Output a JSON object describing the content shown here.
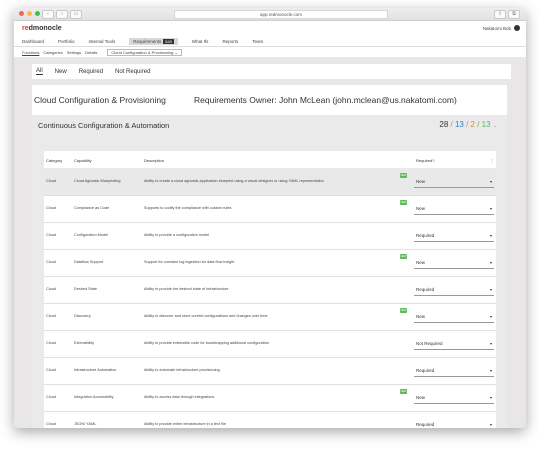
{
  "browser": {
    "url": "app.redmonocle.com",
    "colors": {
      "close": "#fc605c",
      "minimize": "#fdbc40",
      "maximize": "#34c84a"
    }
  },
  "app": {
    "logo_prefix": "re",
    "logo_suffix": "dmonocle",
    "user_name": "Nakatomi Bob"
  },
  "mainnav": {
    "items": [
      "Dashboard",
      "Portfolio",
      "Internal Tools",
      "Requirements",
      "What Ifs",
      "Reports",
      "Team"
    ],
    "requirements_badge": "543"
  },
  "subnav": {
    "items": [
      "Functions",
      "Categories",
      "Settings",
      "Details"
    ],
    "selected": "Cloud Configuration & Provisioning"
  },
  "filters": [
    "All",
    "New",
    "Required",
    "Not Required"
  ],
  "page": {
    "title": "Cloud Configuration & Provisioning",
    "owner": "Requirements Owner: John McLean (john.mclean@us.nakatomi.com)"
  },
  "section": {
    "title": "Continuous Configuration & Automation",
    "counts": {
      "total": "28",
      "blue": "13",
      "orange": "2",
      "green": "13"
    },
    "count_colors": {
      "total": "#333333",
      "blue": "#3a7fc4",
      "orange": "#e0902a",
      "green": "#5cb85c"
    }
  },
  "table": {
    "headers": {
      "category": "Category",
      "capability": "Capability",
      "description": "Description",
      "required": "Required?"
    },
    "new_tag": "NEW",
    "rows": [
      {
        "category": "Cloud",
        "capability": "Cloud Agnostic Blueprinting",
        "description": "Ability to create a cloud agnostic application blueprint using a visual designer or using YAML representation",
        "required": "New",
        "is_new": true
      },
      {
        "category": "Cloud",
        "capability": "Compliance as Code",
        "description": "Supports to codify the compliance with custom rules",
        "required": "New",
        "is_new": true
      },
      {
        "category": "Cloud",
        "capability": "Configuration Model",
        "description": "Ability to provide a configuration model",
        "required": "Required",
        "is_new": false
      },
      {
        "category": "Cloud",
        "capability": "Dataflow Support",
        "description": "Support for constant log ingestion for data flow insight",
        "required": "New",
        "is_new": true
      },
      {
        "category": "Cloud",
        "capability": "Desired State",
        "description": "Ability to provide the desired state of infrastructure",
        "required": "Required",
        "is_new": false
      },
      {
        "category": "Cloud",
        "capability": "Discovery",
        "description": "Ability to discover and store current configurations and changes over time",
        "required": "New",
        "is_new": true
      },
      {
        "category": "Cloud",
        "capability": "Extensibility",
        "description": "Ability to provide extensible code for bootstrapping additional configuration",
        "required": "Not Required",
        "is_new": false
      },
      {
        "category": "Cloud",
        "capability": "Infrastructure Automation",
        "description": "Ability to automate infrastructure provisioning",
        "required": "Required",
        "is_new": false
      },
      {
        "category": "Cloud",
        "capability": "Integration Accessibility",
        "description": "Ability to access data through integrations",
        "required": "New",
        "is_new": true
      },
      {
        "category": "Cloud",
        "capability": "JSON/ YAML",
        "description": "Ability to provide entire infrastructure in a text file",
        "required": "Required",
        "is_new": false
      }
    ]
  }
}
